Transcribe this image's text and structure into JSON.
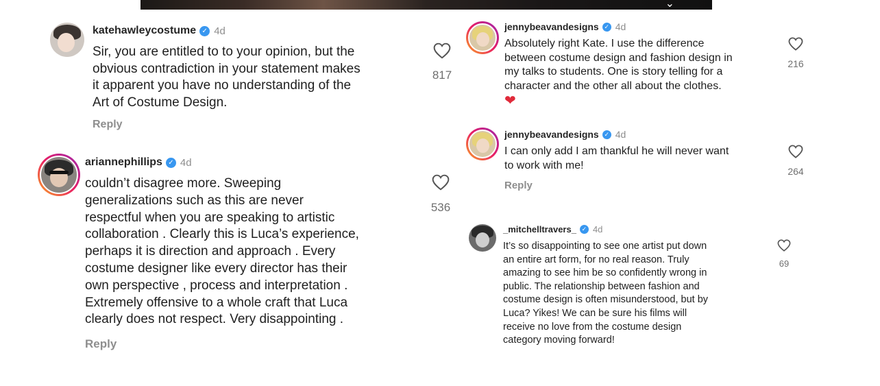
{
  "top_media": {
    "arrow_icon": "⌄"
  },
  "comments": [
    {
      "username": "katehawleycostume",
      "verified": "✓",
      "time": "4d",
      "lines": [
        "Sir, you are entitled to to your opinion, but the",
        "obvious contradiction in your statement makes",
        "it apparent you have no understanding of the",
        "Art of Costume Design."
      ],
      "likes": "817",
      "reply": "Reply"
    },
    {
      "username": "ariannephillips",
      "verified": "✓",
      "time": "4d",
      "lines": [
        "couldn’t disagree more.  Sweeping",
        "generalizations such as this are never",
        "respectful when you are speaking to artistic",
        "collaboration . Clearly this is Luca’s experience,",
        "perhaps it is direction and approach . Every",
        "costume designer like every director has their",
        "own perspective , process and interpretation .",
        "Extremely offensive to a whole craft that Luca",
        "clearly does not respect. Very disappointing ."
      ],
      "likes": "536",
      "reply": "Reply"
    },
    {
      "username": "jennybeavandesigns",
      "verified": "✓",
      "time": "4d",
      "lines": [
        "Absolutely right Kate. I use the difference",
        "between costume design and fashion design in",
        "my talks to students. One is story telling for a",
        "character and the other all about the clothes."
      ],
      "emoji": "❤",
      "likes": "216"
    },
    {
      "username": "jennybeavandesigns",
      "verified": "✓",
      "time": "4d",
      "lines": [
        "I can only add I am thankful he will never want",
        "to work with me!"
      ],
      "likes": "264",
      "reply": "Reply"
    },
    {
      "username": "_mitchelltravers_",
      "verified": "✓",
      "time": "4d",
      "lines": [
        "It’s so disappointing to see one artist put down",
        "an entire art form, for no real reason. Truly",
        "amazing to see him be so confidently wrong in",
        "public. The relationship between fashion and",
        "costume design is often misunderstood, but by",
        "Luca? Yikes! We can be sure his films will",
        "receive no love from the costume design",
        "category moving forward!"
      ],
      "likes": "69"
    }
  ],
  "colors": {
    "verified": "#3897f0",
    "muted": "#8e8e8e",
    "story_ring": [
      "#f9a825",
      "#e91e63",
      "#9c27b0"
    ]
  }
}
